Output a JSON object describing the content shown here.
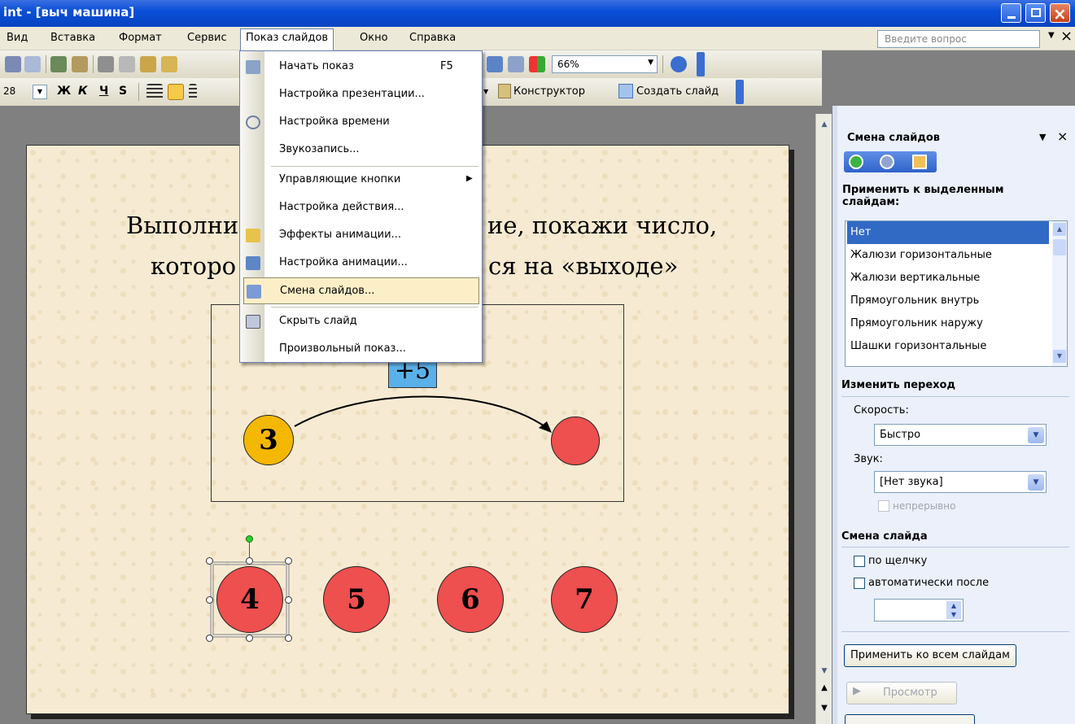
{
  "window": {
    "title": "int - [выч машина]"
  },
  "menubar": {
    "items": [
      {
        "label": "Вид"
      },
      {
        "label": "Вставка"
      },
      {
        "label": "Формат"
      },
      {
        "label": "Сервис"
      },
      {
        "label": "Показ слайдов"
      },
      {
        "label": "Окно"
      },
      {
        "label": "Справка"
      }
    ],
    "help_placeholder": "Введите вопрос",
    "close_glyph": "×"
  },
  "toolbar": {
    "zoom": "66%",
    "font_size": "28",
    "bold": "Ж",
    "italic": "К",
    "underline": "Ч",
    "shadow": "S",
    "designer": "Конструктор",
    "new_slide": "Создать слайд"
  },
  "slide": {
    "line1_left": "Выполни",
    "line1_right": "ие, покажи  число,",
    "line2_left": "которо",
    "line2_right": "ся на «выходе»",
    "op_label": "+5",
    "input_value": "3",
    "choices": [
      "4",
      "5",
      "6",
      "7"
    ]
  },
  "menu": {
    "items": [
      {
        "label": "Начать показ",
        "shortcut": "F5"
      },
      {
        "label": "Настройка презентации..."
      },
      {
        "label": "Настройка времени"
      },
      {
        "label": "Звукозапись..."
      },
      {
        "label": "Управляющие кнопки"
      },
      {
        "label": "Настройка действия..."
      },
      {
        "label": "Эффекты анимации..."
      },
      {
        "label": "Настройка анимации..."
      },
      {
        "label": "Смена слайдов..."
      },
      {
        "label": "Скрыть слайд"
      },
      {
        "label": "Произвольный показ..."
      }
    ]
  },
  "pane": {
    "title": "Смена слайдов",
    "apply_heading": "Применить к выделенным слайдам:",
    "effects": [
      "Нет",
      "Жалюзи горизонтальные",
      "Жалюзи вертикальные",
      "Прямоугольник внутрь",
      "Прямоугольник наружу",
      "Шашки горизонтальные"
    ],
    "change_heading": "Изменить переход",
    "speed_label": "Скорость:",
    "speed_value": "Быстро",
    "sound_label": "Звук:",
    "sound_value": "[Нет звука]",
    "loop_label": "непрерывно",
    "advance_heading": "Смена слайда",
    "on_click_label": "по щелчку",
    "auto_label": "автоматически после",
    "apply_all": "Применить ко всем слайдам",
    "preview": "Просмотр"
  },
  "colors": {
    "accent": "#316ac5",
    "circle": "#ee4f4f",
    "yellow": "#f5b800",
    "menu_highlight": "#fcefc8"
  }
}
